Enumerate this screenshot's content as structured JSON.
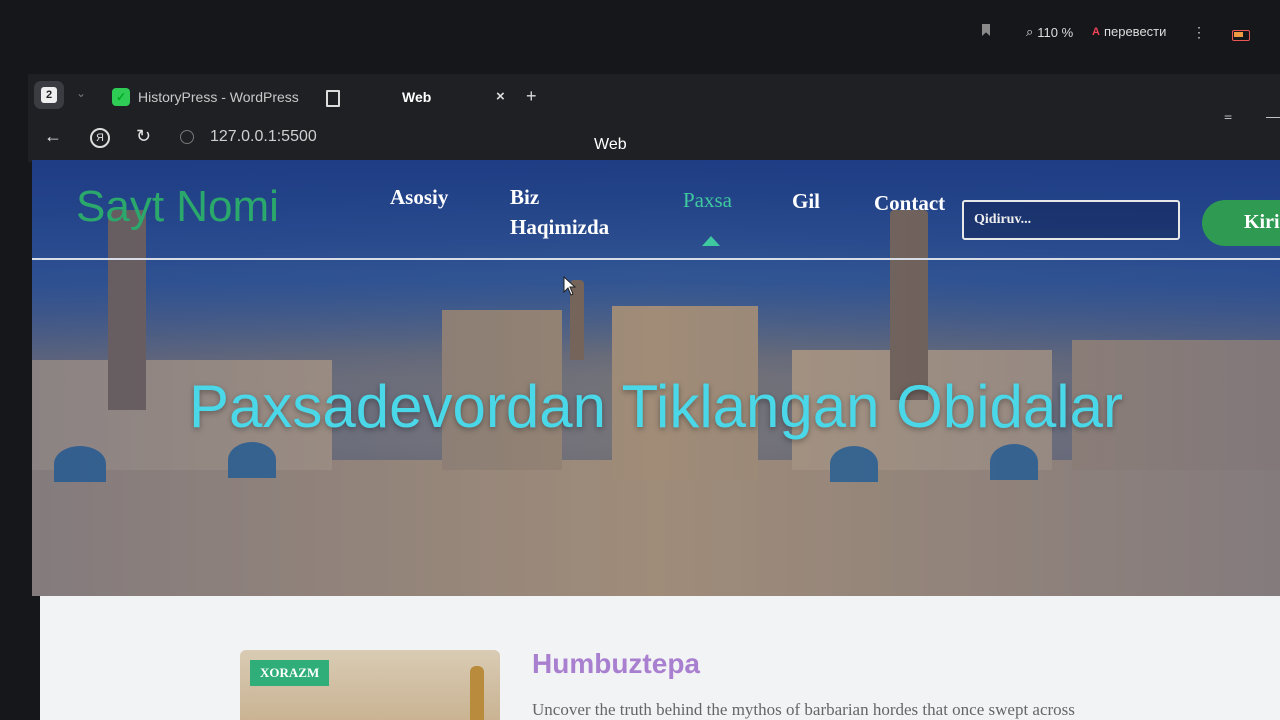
{
  "browser": {
    "tab_count": "2",
    "tabs": [
      {
        "title": "HistoryPress - WordPress",
        "icon": "wordpress-icon"
      },
      {
        "title": "Web",
        "icon": "document-icon"
      }
    ],
    "url": "127.0.0.1:5500",
    "page_title": "Web",
    "zoom": "110 %",
    "translate_label": "перевести",
    "new_tab_symbol": "+",
    "close_symbol": "×"
  },
  "site": {
    "logo": "Sayt Nomi",
    "nav": [
      "Asosiy",
      "Biz Haqimizda",
      "Paxsa",
      "Gil",
      "Contact"
    ],
    "active_nav": "Paxsa",
    "search_placeholder": "Qidiruv...",
    "login_label": "Kirish",
    "hero_title": "Paxsadevordan Tiklangan Obidalar",
    "card": {
      "badge": "XORAZM",
      "title": "Humbuztepa",
      "excerpt": "Uncover the truth behind the mythos of barbarian hordes that once swept across"
    }
  },
  "colors": {
    "logo": "#2ba86b",
    "active_nav": "#3fc9a0",
    "hero_title": "#4ad7e8",
    "login_button": "#2e9a52",
    "post_title": "#a97fcf"
  }
}
